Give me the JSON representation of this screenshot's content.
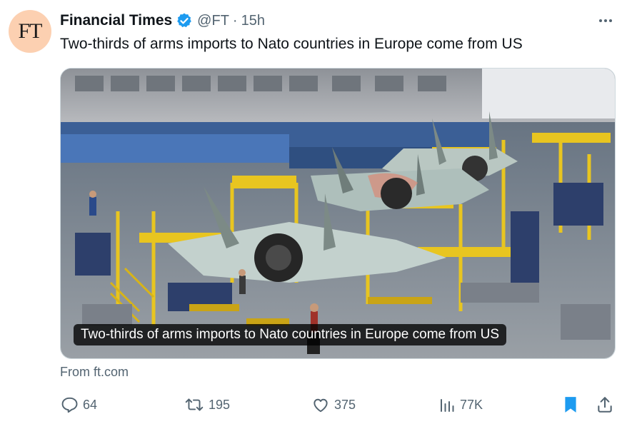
{
  "author": {
    "avatar_text": "FT",
    "display_name": "Financial Times",
    "handle": "@FT",
    "separator": "·",
    "time": "15h",
    "verified_color": "#1d9bf0"
  },
  "tweet": {
    "text": "Two-thirds of arms imports to Nato countries in Europe come from US"
  },
  "card": {
    "caption": "Two-thirds of arms imports to Nato countries in Europe come from US",
    "source": "From ft.com"
  },
  "actions": {
    "replies": "64",
    "reposts": "195",
    "likes": "375",
    "views": "77K"
  },
  "colors": {
    "secondary_text": "#536471",
    "bookmark_active": "#1d9bf0",
    "avatar_bg": "#fcd0b1"
  },
  "icons": [
    "more-icon",
    "verified-badge-icon",
    "reply-icon",
    "repost-icon",
    "like-icon",
    "views-icon",
    "bookmark-icon",
    "share-icon"
  ]
}
